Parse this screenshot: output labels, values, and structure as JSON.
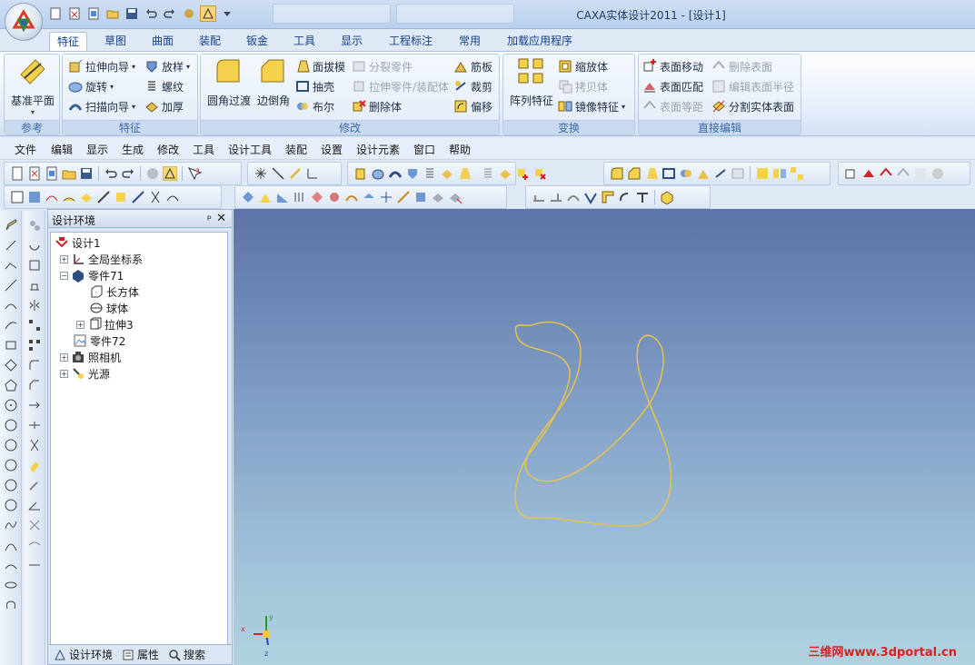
{
  "window": {
    "title": "CAXA实体设计2011 - [设计1]"
  },
  "ribbon_tabs": [
    "特征",
    "草图",
    "曲面",
    "装配",
    "钣金",
    "工具",
    "显示",
    "工程标注",
    "常用",
    "加载应用程序"
  ],
  "ribbon": {
    "ref_group": {
      "label": "参考",
      "big": "基准平面"
    },
    "feature_group": {
      "label": "特征",
      "items": [
        "拉伸向导",
        "旋转",
        "扫描向导",
        "放样",
        "螺纹",
        "加厚"
      ]
    },
    "modify_group": {
      "label": "修改",
      "big1": "圆角过渡",
      "big2": "边倒角",
      "items": [
        "面拔模",
        "抽壳",
        "布尔",
        "分裂零件",
        "拉伸零件/装配体",
        "删除体",
        "筋板",
        "裁剪",
        "偏移"
      ]
    },
    "transform_group": {
      "label": "变换",
      "big": "阵列特征",
      "items": [
        "缩放体",
        "拷贝体",
        "镜像特征"
      ]
    },
    "direct_group": {
      "label": "直接编辑",
      "items": [
        "表面移动",
        "表面匹配",
        "表面等距",
        "删除表面",
        "编辑表面半径",
        "分割实体表面"
      ]
    }
  },
  "menu": [
    "文件",
    "编辑",
    "显示",
    "生成",
    "修改",
    "工具",
    "设计工具",
    "装配",
    "设置",
    "设计元素",
    "窗口",
    "帮助"
  ],
  "panel": {
    "title": "设计环境",
    "pin": "ᵖ",
    "close": "✕",
    "tree": [
      "设计1",
      "全局坐标系",
      "零件71",
      "长方体",
      "球体",
      "拉伸3",
      "零件72",
      "照相机",
      "光源"
    ],
    "tabs": [
      "设计环境",
      "属性",
      "搜索"
    ]
  },
  "viewport": {
    "watermark": "三维网www.3dportal.cn",
    "axes": [
      "x",
      "y",
      "z"
    ],
    "curve_color": "#e8c24a"
  }
}
